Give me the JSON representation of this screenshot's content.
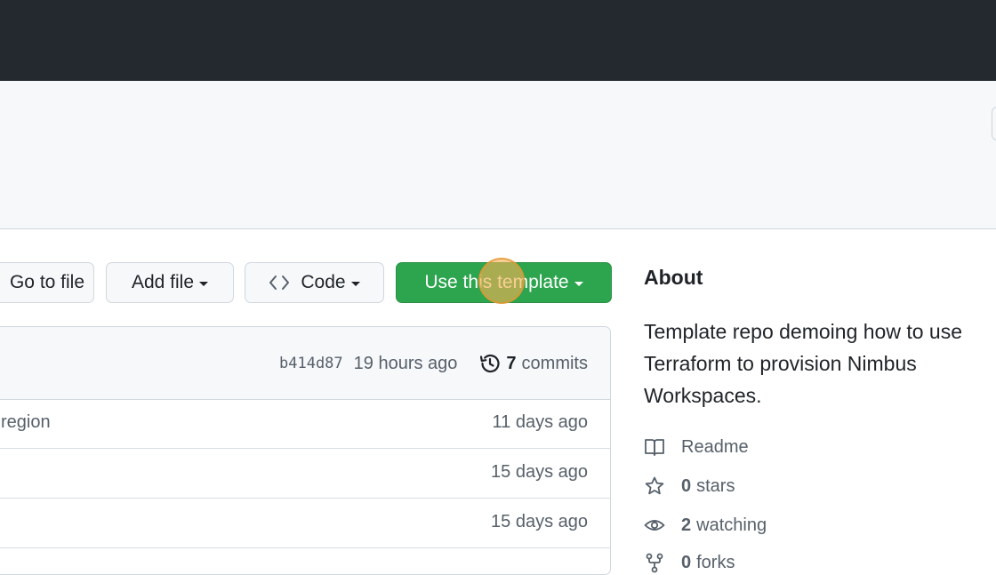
{
  "toolbar": {
    "go_to_file": "Go to file",
    "add_file": "Add file",
    "code": "Code",
    "use_template": "Use this template"
  },
  "commit_bar": {
    "sha": "b414d87",
    "time": "19 hours ago",
    "commits_count": "7",
    "commits_label": "commits"
  },
  "files": [
    {
      "message": "region",
      "age": "11 days ago"
    },
    {
      "message": "",
      "age": "15 days ago"
    },
    {
      "message": "",
      "age": "15 days ago"
    }
  ],
  "about": {
    "title": "About",
    "description": "Template repo demoing how to use Terraform to provision Nimbus Workspaces.",
    "readme": "Readme",
    "stars_count": "0",
    "stars_label": "stars",
    "watching_count": "2",
    "watching_label": "watching",
    "forks_count": "0",
    "forks_label": "forks"
  },
  "icons": {
    "code": "code-icon",
    "history": "history-icon",
    "readme": "book-icon",
    "stars": "star-icon",
    "watching": "eye-icon",
    "forks": "fork-icon"
  },
  "colors": {
    "topbar": "#24292f",
    "primary_button": "#2da44e",
    "header_bg": "#f6f8fa"
  }
}
